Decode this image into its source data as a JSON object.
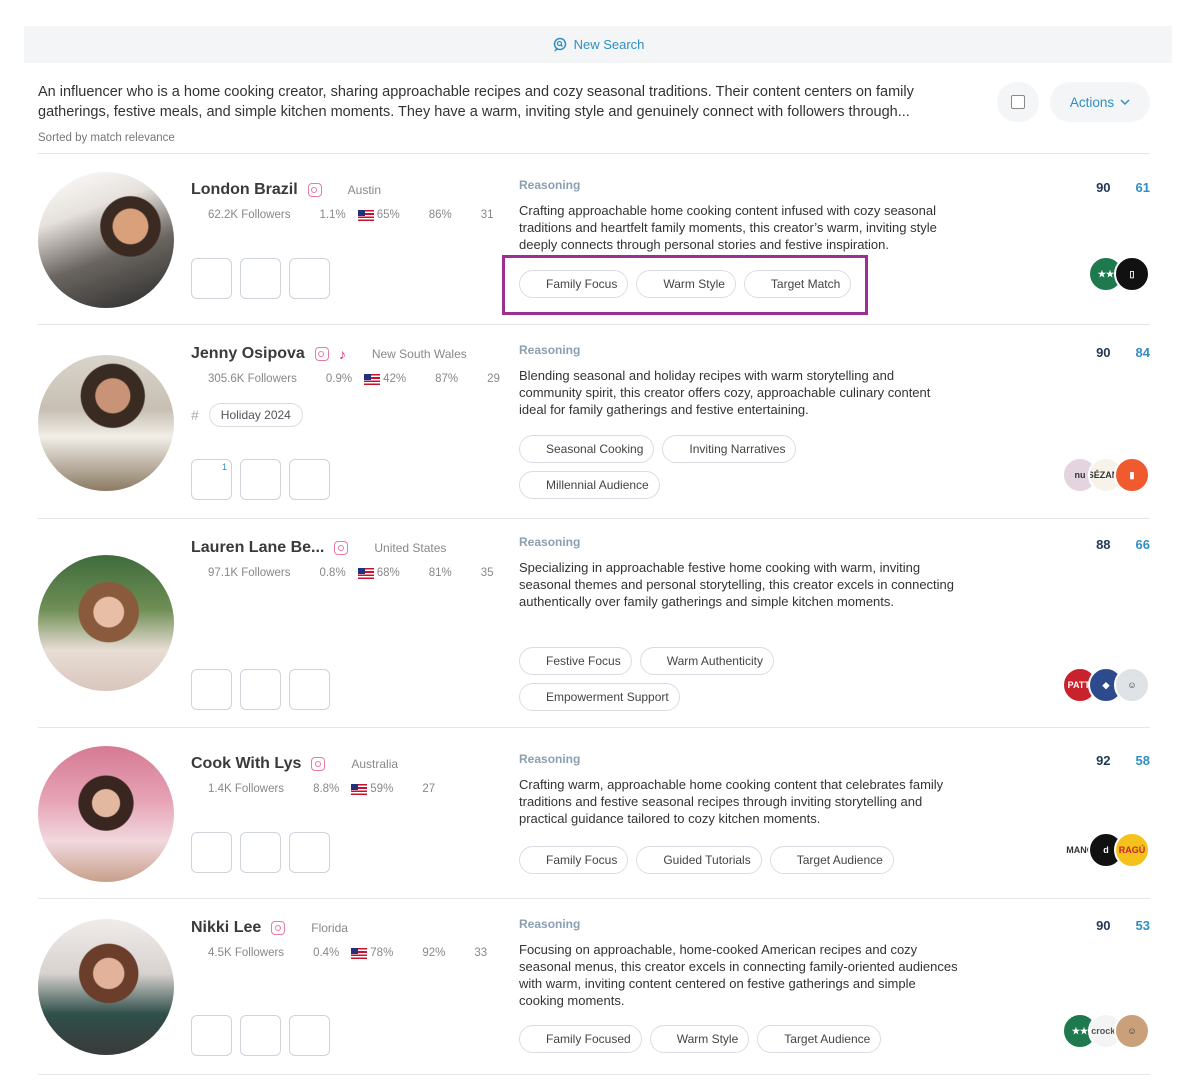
{
  "topbar": {
    "new_search_label": "New Search"
  },
  "query": {
    "text": "An influencer who is a home cooking creator, sharing approachable recipes and cozy seasonal traditions. Their content centers on family gatherings, festive meals, and simple kitchen moments. They have a warm, inviting style and genuinely connect with followers through...",
    "sorted_label": "Sorted by match relevance"
  },
  "toolbar": {
    "actions_label": "Actions"
  },
  "reasoning_label": "Reasoning",
  "creators": [
    {
      "name": "London Brazil",
      "location": "Austin",
      "followers": "62.2K Followers",
      "engagement": "1.1%",
      "us_audience": "65%",
      "female_audience": "86%",
      "age": "31",
      "reasoning": "Crafting approachable home cooking content infused with cozy seasonal traditions and heartfelt family moments, this creator’s warm, inviting style deeply connects through personal stories and festive inspiration.",
      "chips": [
        "Family Focus",
        "Warm Style",
        "Target Match"
      ],
      "score_a": "90",
      "score_b": "61",
      "brands": [
        {
          "label": "★★",
          "bg": "#1e7a4e",
          "fg": "#ffffff"
        },
        {
          "label": "▯",
          "bg": "#111111",
          "fg": "#ffffff"
        }
      ]
    },
    {
      "name": "Jenny Osipova",
      "location": "New South Wales",
      "followers": "305.6K Followers",
      "engagement": "0.9%",
      "us_audience": "42%",
      "female_audience": "87%",
      "age": "29",
      "hashtag_pill": "Holiday 2024",
      "hashtag_count": "1",
      "reasoning": "Blending seasonal and holiday recipes with warm storytelling and community spirit, this creator offers cozy, approachable culinary content ideal for family gatherings and festive entertaining.",
      "chips": [
        "Seasonal Cooking",
        "Inviting Narratives",
        "Millennial Audience"
      ],
      "score_a": "90",
      "score_b": "84",
      "brands": [
        {
          "label": "nu",
          "bg": "#e3d4e0",
          "fg": "#333333"
        },
        {
          "label": "SÉZANE",
          "bg": "#f7f2ea",
          "fg": "#333333"
        },
        {
          "label": "▮",
          "bg": "#ef5a2f",
          "fg": "#ffffff"
        }
      ]
    },
    {
      "name": "Lauren Lane Be...",
      "location": "United States",
      "followers": "97.1K Followers",
      "engagement": "0.8%",
      "us_audience": "68%",
      "female_audience": "81%",
      "age": "35",
      "reasoning": "Specializing in approachable festive home cooking with warm, inviting seasonal themes and personal storytelling, this creator excels in connecting authentically over family gatherings and simple kitchen moments.",
      "chips": [
        "Festive Focus",
        "Warm Authenticity",
        "Empowerment Support"
      ],
      "score_a": "88",
      "score_b": "66",
      "brands": [
        {
          "label": "PATTI",
          "bg": "#c8232c",
          "fg": "#ffffff"
        },
        {
          "label": "◆",
          "bg": "#2c4a8c",
          "fg": "#ffffff"
        },
        {
          "label": "☺",
          "bg": "#dfe3e6",
          "fg": "#333333"
        }
      ]
    },
    {
      "name": "Cook With Lys",
      "location": "Australia",
      "followers": "1.4K Followers",
      "engagement": "8.8%",
      "us_audience": "59%",
      "age": "27",
      "reasoning": "Crafting warm, approachable home cooking content that celebrates family traditions and festive seasonal recipes through inviting storytelling and practical guidance tailored to cozy kitchen moments.",
      "chips": [
        "Family Focus",
        "Guided Tutorials",
        "Target Audience"
      ],
      "score_a": "92",
      "score_b": "58",
      "brands": [
        {
          "label": "MANO",
          "bg": "#ffffff",
          "fg": "#333333"
        },
        {
          "label": "d",
          "bg": "#111111",
          "fg": "#ffffff"
        },
        {
          "label": "RAGÚ",
          "bg": "#f4c21b",
          "fg": "#c8232c"
        }
      ]
    },
    {
      "name": "Nikki Lee",
      "location": "Florida",
      "followers": "4.5K Followers",
      "engagement": "0.4%",
      "us_audience": "78%",
      "female_audience": "92%",
      "age": "33",
      "reasoning": "Focusing on approachable, home-cooked American recipes and cozy seasonal menus, this creator excels in connecting family-oriented audiences with warm, inviting content centered on festive gatherings and simple cooking moments.",
      "chips": [
        "Family Focused",
        "Warm Style",
        "Target Audience"
      ],
      "score_a": "90",
      "score_b": "53",
      "brands": [
        {
          "label": "★★",
          "bg": "#1e7a4e",
          "fg": "#ffffff"
        },
        {
          "label": "crockp",
          "bg": "#f4f4f4",
          "fg": "#555555"
        },
        {
          "label": "☺",
          "bg": "#c9a07a",
          "fg": "#333333"
        }
      ]
    }
  ]
}
